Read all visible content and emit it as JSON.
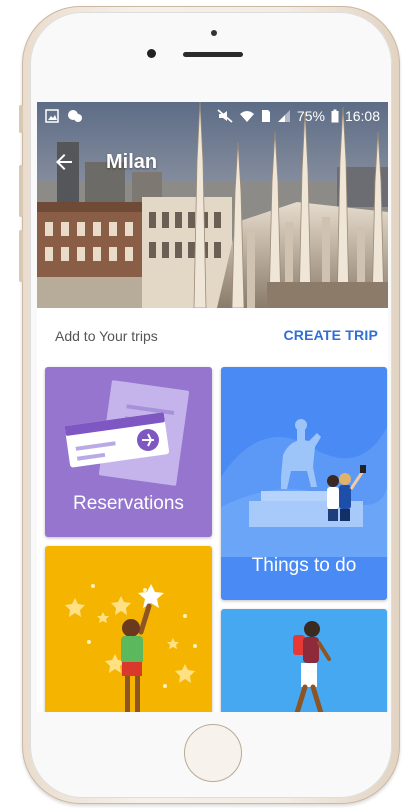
{
  "status_bar": {
    "battery": "75%",
    "time": "16:08",
    "icons": [
      "image-icon",
      "chat-icon",
      "mute-icon",
      "wifi-icon",
      "sim-icon",
      "signal-icon",
      "battery-icon"
    ]
  },
  "app_bar": {
    "title": "Milan",
    "back_icon": "arrow-left-icon"
  },
  "section": {
    "label": "Add to Your trips",
    "action": "CREATE TRIP"
  },
  "cards": [
    {
      "label": "Reservations",
      "color": "#9575cd"
    },
    {
      "label": "Things to do",
      "color": "#4285f4"
    },
    {
      "label": "",
      "color": "#f4b400"
    },
    {
      "label": "",
      "color": "#42a5f5"
    }
  ],
  "colors": {
    "accent": "#2f6fd6",
    "card_purple": "#9575cd",
    "card_blue": "#4a8af4",
    "card_yellow": "#f4b400",
    "card_light_blue": "#45a8f0"
  }
}
